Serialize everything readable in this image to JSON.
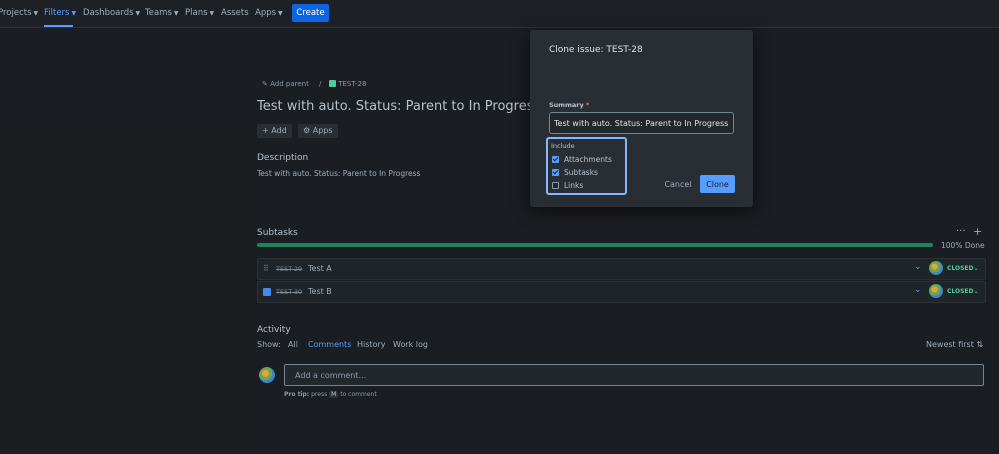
{
  "nav": {
    "projects": "Projects",
    "filters": "Filters",
    "dashboards": "Dashboards",
    "teams": "Teams",
    "plans": "Plans",
    "assets": "Assets",
    "apps": "Apps",
    "create": "Create"
  },
  "issue": {
    "add_parent": "Add parent",
    "key": "TEST-28",
    "title": "Test with auto. Status: Parent to In Progress",
    "add_label": "Add",
    "apps_label": "Apps",
    "description_heading": "Description",
    "description_text": "Test with auto. Status: Parent to In Progress"
  },
  "subtasks": {
    "heading": "Subtasks",
    "progress_label": "100% Done",
    "progress_fraction": 1.0,
    "items": [
      {
        "key": "TEST-29",
        "name": "Test A",
        "status": "CLOSED"
      },
      {
        "key": "TEST-30",
        "name": "Test B",
        "status": "CLOSED"
      }
    ]
  },
  "activity": {
    "heading": "Activity",
    "show_label": "Show:",
    "tabs": [
      "All",
      "Comments",
      "History",
      "Work log"
    ],
    "sort": "Newest first",
    "comment_placeholder": "Add a comment...",
    "protip_prefix": "Pro tip:",
    "protip_press": "press",
    "protip_key": "M",
    "protip_suffix": "to comment"
  },
  "modal": {
    "title": "Clone issue: TEST-28",
    "summary_label": "Summary",
    "required_mark": "*",
    "summary_value": "Test with auto. Status: Parent to In Progress",
    "include_label": "Include",
    "options": [
      {
        "label": "Attachments",
        "checked": true
      },
      {
        "label": "Subtasks",
        "checked": true
      },
      {
        "label": "Links",
        "checked": false
      }
    ],
    "cancel": "Cancel",
    "clone": "Clone"
  },
  "colors": {
    "accent": "#579dff",
    "progress": "#1f845a",
    "status_closed": "#4bce97",
    "primary_button": "#0c66e4"
  }
}
